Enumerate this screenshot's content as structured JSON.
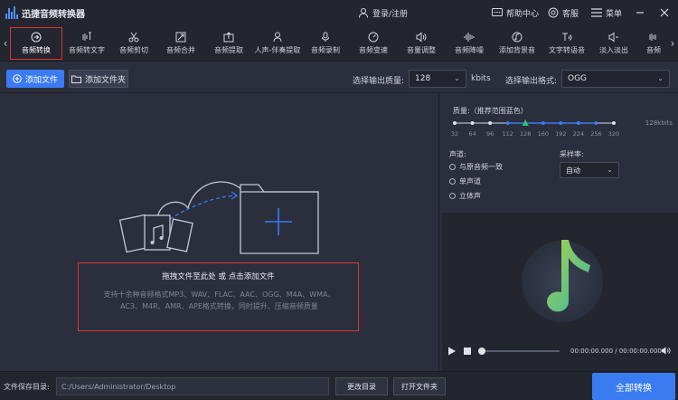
{
  "app": {
    "title": "迅捷音频转换器",
    "login_label": "登录/注册",
    "help_label": "帮助中心",
    "service_label": "客服",
    "menu_label": "菜单"
  },
  "toolbar": {
    "items": [
      {
        "label": "音频转换",
        "icon": "convert-icon",
        "active": true
      },
      {
        "label": "音频转文字",
        "icon": "audio-to-text-icon"
      },
      {
        "label": "音频剪切",
        "icon": "scissors-icon"
      },
      {
        "label": "音频合并",
        "icon": "merge-icon"
      },
      {
        "label": "音频提取",
        "icon": "extract-icon"
      },
      {
        "label": "人声-伴奏提取",
        "icon": "vocal-icon"
      },
      {
        "label": "音频录制",
        "icon": "microphone-icon"
      },
      {
        "label": "音频变速",
        "icon": "speed-icon"
      },
      {
        "label": "音量调整",
        "icon": "volume-icon"
      },
      {
        "label": "音频降噪",
        "icon": "denoise-icon"
      },
      {
        "label": "添加背景音",
        "icon": "background-music-icon"
      },
      {
        "label": "文字转语音",
        "icon": "text-to-speech-icon"
      },
      {
        "label": "淡入淡出",
        "icon": "fade-icon"
      },
      {
        "label": "音频",
        "icon": "more-icon"
      }
    ]
  },
  "subbar": {
    "add_file_label": "添加文件",
    "add_folder_label": "添加文件夹",
    "quality_label": "选择输出质量:",
    "quality_value": "128",
    "quality_unit": "kbits",
    "format_label": "选择输出格式:",
    "format_value": "OGG"
  },
  "dropzone": {
    "title": "拖拽文件至此处 或 点击添加文件",
    "description": "支持十余种音频格式MP3、WAV、FLAC、AAC、OGG、M4A、WMA、AC3、M4R、AMR、APE格式转换，同时提升、压缩音频质量"
  },
  "settings": {
    "quality_title": "质量:（推荐范围蓝色）",
    "quality_ticks": [
      "32",
      "64",
      "96",
      "112",
      "128",
      "160",
      "192",
      "224",
      "256",
      "320"
    ],
    "quality_selected": "128",
    "quality_readout": "128kbits",
    "channel_title": "声道:",
    "channel_options": [
      "与原音频一致",
      "单声道",
      "立体声"
    ],
    "samplerate_title": "采样率:",
    "samplerate_value": "自动"
  },
  "player": {
    "time": "00:00:00.000 / 00:00:00.000",
    "progress": 0
  },
  "bottom": {
    "save_dir_label": "文件保存目录:",
    "save_dir_value": "C:/Users/Administrator/Desktop",
    "change_dir_label": "更改目录",
    "open_folder_label": "打开文件夹",
    "convert_all_label": "全部转换"
  },
  "colors": {
    "accent": "#3a7bf2",
    "highlight_red": "#d9372d",
    "tick_green": "#36c26a",
    "note_green": "#8fce4a"
  }
}
